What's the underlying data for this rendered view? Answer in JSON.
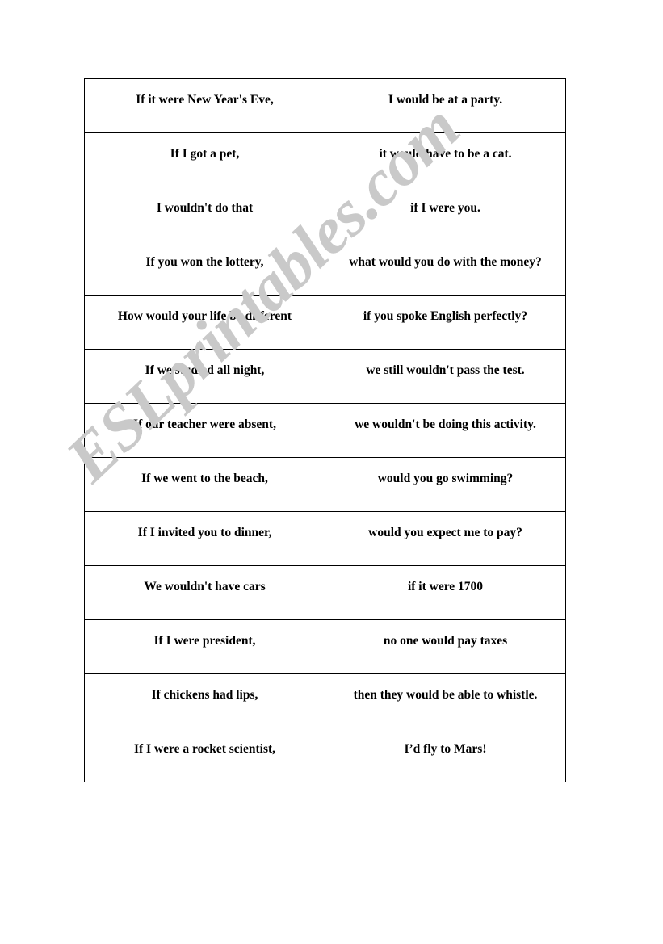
{
  "page": {
    "background_color": "#ffffff",
    "watermark": {
      "text": "ESLprintables.com",
      "color": "#c9c9c9"
    }
  },
  "worksheet": {
    "type": "matching-activity",
    "border_color": "#000000",
    "text_color": "#000000",
    "columns": 2,
    "row_count": 13,
    "rows": [
      {
        "left": "If it were New Year's Eve,",
        "right": "I would be at a party."
      },
      {
        "left": "If I got a pet,",
        "right": "it would have to be a cat."
      },
      {
        "left": "I wouldn't do that",
        "right": "if I were you."
      },
      {
        "left": "If you won the lottery,",
        "right": "what would you do with the money?"
      },
      {
        "left": "How would your life be different",
        "right": "if you spoke English perfectly?"
      },
      {
        "left": "If we studied all night,",
        "right": "we still wouldn't pass the test."
      },
      {
        "left": "If our teacher were absent,",
        "right": "we wouldn't be doing this activity."
      },
      {
        "left": "If we went to the beach,",
        "right": "would you go swimming?"
      },
      {
        "left": "If I invited you to dinner,",
        "right": "would you expect me to pay?"
      },
      {
        "left": "We wouldn't have cars",
        "right": "if it were 1700"
      },
      {
        "left": "If I were president,",
        "right": "no one would pay taxes"
      },
      {
        "left": "If chickens had lips,",
        "right": "then they would be able to whistle."
      },
      {
        "left": "If I were a rocket scientist,",
        "right": "I’d fly to Mars!"
      }
    ]
  }
}
